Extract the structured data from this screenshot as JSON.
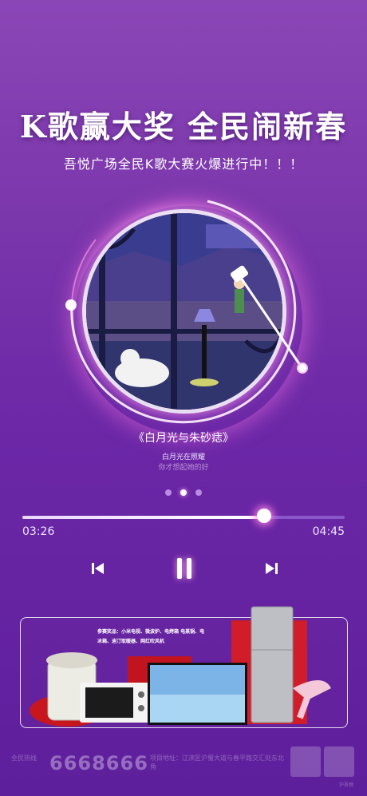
{
  "headline": "K歌赢大奖  全民闹新春",
  "subheadline": "吾悦广场全民K歌大赛火爆进行中！！！",
  "song": {
    "title": "《白月光与朱砂痣》",
    "lyric_current": "白月光在照耀",
    "lyric_next": "你才想起她的好"
  },
  "player": {
    "elapsed": "03:26",
    "duration": "04:45",
    "progress": 0.75,
    "page_dots": 3,
    "active_dot": 1
  },
  "prizes": {
    "text": "参赛奖品：小米电视、微波炉、电烤箱 电蒸锅、电冰箱、迪汀取暖器、网红吹风机"
  },
  "footer": {
    "phone_label": "全民热线",
    "phone": "6668666",
    "address": "项目地址：江滨区沪蜀大道与春平路交汇处东北角",
    "qr_caption": "沪吾悦"
  },
  "colors": {
    "accent_glow": "#ff8fe6",
    "background_top": "#8b46b6",
    "background_bottom": "#5e1f9c",
    "prize_red": "#d11d2a"
  }
}
